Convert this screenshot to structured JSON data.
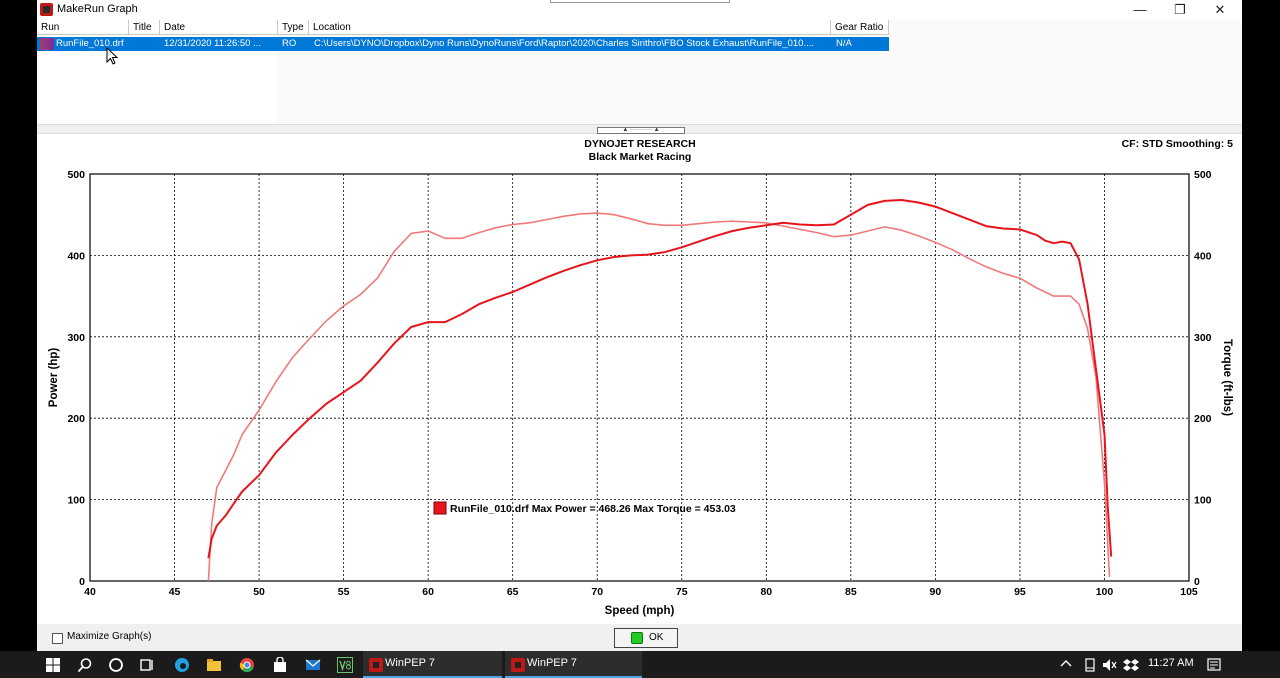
{
  "window": {
    "title": "MakeRun Graph",
    "minimize": "—",
    "restore": "❐",
    "close": "✕"
  },
  "grid": {
    "headers": [
      "Run",
      "Title",
      "Date",
      "Type",
      "Location",
      "Gear Ratio"
    ],
    "row": {
      "run": "RunFile_010.drf",
      "title": "",
      "date": "12/31/2020 11:26:50 ...",
      "type": "RO",
      "location": "C:\\Users\\DYNO\\Dropbox\\Dyno Runs\\DynoRuns\\Ford\\Raptor\\2020\\Charles Sirithro\\FBO Stock Exhaust\\RunFile_010....",
      "gear_ratio": "N/A"
    }
  },
  "chart_header": {
    "line1": "DYNOJET RESEARCH",
    "line2": "Black Market Racing",
    "settings": "CF: STD  Smoothing: 5"
  },
  "chart_data": {
    "type": "line",
    "xlabel": "Speed (mph)",
    "ylabel": "Power (hp)",
    "y2label": "Torque (ft-lbs)",
    "xlim": [
      40,
      105
    ],
    "ylim": [
      0,
      500
    ],
    "y2lim": [
      0,
      500
    ],
    "xticks": [
      40,
      45,
      50,
      55,
      60,
      65,
      70,
      75,
      80,
      85,
      90,
      95,
      100,
      105
    ],
    "yticks": [
      0,
      100,
      200,
      300,
      400,
      500
    ],
    "grid": true,
    "legend_text": "RunFile_010.drf Max Power = 468.26 Max Torque = 453.03",
    "series": [
      {
        "axis": "left",
        "color": "#e8141c",
        "x": [
          47.0,
          47.2,
          47.5,
          48.0,
          48.5,
          49.0,
          50.0,
          51.0,
          52.0,
          53.0,
          54.0,
          55.0,
          56.0,
          57.0,
          58.0,
          59.0,
          60.0,
          61.0,
          62.0,
          63.0,
          64.0,
          65.0,
          66.0,
          67.0,
          68.0,
          69.0,
          70.0,
          71.0,
          72.0,
          73.0,
          74.0,
          75.0,
          76.0,
          77.0,
          78.0,
          79.0,
          80.0,
          81.0,
          82.0,
          83.0,
          84.0,
          85.0,
          86.0,
          87.0,
          88.0,
          89.0,
          90.0,
          91.0,
          92.0,
          93.0,
          94.0,
          95.0,
          96.0,
          96.5,
          97.0,
          97.5,
          98.0,
          98.5,
          99.0,
          99.5,
          100.0,
          100.2,
          100.4
        ],
        "y": [
          28,
          52,
          68,
          80,
          95,
          110,
          130,
          158,
          180,
          200,
          218,
          232,
          246,
          268,
          292,
          312,
          318,
          318,
          328,
          340,
          348,
          355,
          364,
          373,
          381,
          388,
          394,
          398,
          400,
          401,
          404,
          410,
          417,
          424,
          430,
          434,
          437,
          440,
          438,
          437,
          438,
          450,
          462,
          467,
          468,
          465,
          460,
          452,
          444,
          436,
          433,
          432,
          425,
          418,
          415,
          417,
          415,
          395,
          340,
          260,
          180,
          90,
          30
        ]
      },
      {
        "axis": "right",
        "color": "#f07a7a",
        "x": [
          47.0,
          47.2,
          47.5,
          48.0,
          48.5,
          49.0,
          50.0,
          51.0,
          52.0,
          53.0,
          54.0,
          55.0,
          56.0,
          57.0,
          58.0,
          59.0,
          60.0,
          61.0,
          62.0,
          63.0,
          64.0,
          65.0,
          66.0,
          67.0,
          68.0,
          69.0,
          70.0,
          71.0,
          72.0,
          73.0,
          74.0,
          75.0,
          76.0,
          77.0,
          78.0,
          79.0,
          80.0,
          81.0,
          82.0,
          83.0,
          84.0,
          85.0,
          86.0,
          87.0,
          88.0,
          89.0,
          90.0,
          91.0,
          92.0,
          93.0,
          94.0,
          95.0,
          96.0,
          97.0,
          98.0,
          98.5,
          99.0,
          99.5,
          100.0,
          100.3
        ],
        "y": [
          0,
          70,
          115,
          135,
          155,
          180,
          210,
          245,
          275,
          298,
          320,
          338,
          352,
          372,
          405,
          427,
          430,
          421,
          421,
          428,
          434,
          438,
          440,
          444,
          448,
          451,
          452,
          450,
          445,
          439,
          437,
          437,
          439,
          441,
          442,
          441,
          440,
          436,
          432,
          428,
          423,
          425,
          430,
          435,
          431,
          424,
          416,
          407,
          396,
          386,
          378,
          372,
          360,
          350,
          350,
          340,
          310,
          250,
          120,
          5
        ]
      }
    ]
  },
  "bottom": {
    "maximize_label": "Maximize Graph(s)",
    "ok_label": "OK"
  },
  "taskbar": {
    "apps": [
      {
        "label": "WinPEP 7"
      },
      {
        "label": "WinPEP 7"
      }
    ],
    "time": "11:27 AM"
  }
}
